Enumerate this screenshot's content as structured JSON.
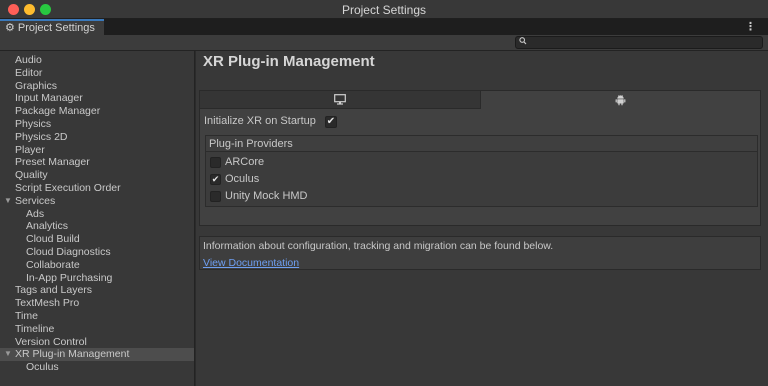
{
  "window": {
    "title": "Project Settings"
  },
  "tab": {
    "label": "Project Settings",
    "icon": "gear-icon"
  },
  "search": {
    "placeholder": "",
    "icon": "search-icon"
  },
  "sidebar": {
    "items": [
      {
        "label": "Audio"
      },
      {
        "label": "Editor"
      },
      {
        "label": "Graphics"
      },
      {
        "label": "Input Manager"
      },
      {
        "label": "Package Manager"
      },
      {
        "label": "Physics"
      },
      {
        "label": "Physics 2D"
      },
      {
        "label": "Player"
      },
      {
        "label": "Preset Manager"
      },
      {
        "label": "Quality"
      },
      {
        "label": "Script Execution Order"
      },
      {
        "label": "Services",
        "expanded": true
      },
      {
        "label": "Ads",
        "child": true
      },
      {
        "label": "Analytics",
        "child": true
      },
      {
        "label": "Cloud Build",
        "child": true
      },
      {
        "label": "Cloud Diagnostics",
        "child": true
      },
      {
        "label": "Collaborate",
        "child": true
      },
      {
        "label": "In-App Purchasing",
        "child": true
      },
      {
        "label": "Tags and Layers"
      },
      {
        "label": "TextMesh Pro"
      },
      {
        "label": "Time"
      },
      {
        "label": "Timeline"
      },
      {
        "label": "Version Control"
      },
      {
        "label": "XR Plug-in Management",
        "expanded": true,
        "selected": true
      },
      {
        "label": "Oculus",
        "child": true
      }
    ]
  },
  "main": {
    "title": "XR Plug-in Management",
    "platform_tabs": [
      {
        "icon": "desktop-monitor-icon",
        "active": false
      },
      {
        "icon": "android-icon",
        "active": true
      }
    ],
    "initialize_label": "Initialize XR on Startup",
    "initialize_checked": true,
    "providers_header": "Plug-in Providers",
    "providers": [
      {
        "label": "ARCore",
        "checked": false
      },
      {
        "label": "Oculus",
        "checked": true
      },
      {
        "label": "Unity Mock HMD",
        "checked": false
      }
    ],
    "info_text": "Information about configuration, tracking and migration can be found below.",
    "doc_link": "View Documentation"
  },
  "colors": {
    "window_bg": "#383838",
    "tab_accent": "#3a79bb",
    "link": "#6e9ff2",
    "selected_row": "#4d4d4d"
  }
}
